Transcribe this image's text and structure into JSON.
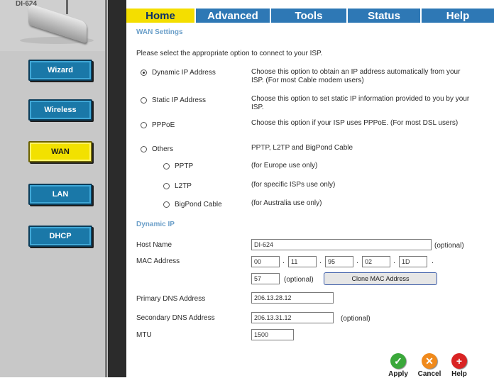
{
  "device": {
    "model": "DI-624"
  },
  "nav": {
    "items": [
      {
        "label": "Wizard"
      },
      {
        "label": "Wireless"
      },
      {
        "label": "WAN"
      },
      {
        "label": "LAN"
      },
      {
        "label": "DHCP"
      }
    ],
    "active": "WAN"
  },
  "tabs": [
    {
      "label": "Home",
      "active": true
    },
    {
      "label": "Advanced"
    },
    {
      "label": "Tools"
    },
    {
      "label": "Status"
    },
    {
      "label": "Help"
    }
  ],
  "wan": {
    "title": "WAN Settings",
    "intro": "Please select the appropriate option to connect to your ISP.",
    "options": [
      {
        "label": "Dynamic IP Address",
        "desc": "Choose this option to obtain an IP address automatically from your ISP. (For most Cable modem users)",
        "checked": true
      },
      {
        "label": "Static IP Address",
        "desc": "Choose this option to set static IP information provided to you by your ISP.",
        "checked": false
      },
      {
        "label": "PPPoE",
        "desc": "Choose this option if your ISP uses PPPoE. (For most DSL users)",
        "checked": false
      },
      {
        "label": "Others",
        "desc": "PPTP, L2TP and BigPond Cable",
        "checked": false
      }
    ],
    "sub_options": [
      {
        "label": "PPTP",
        "desc": "(for Europe use only)"
      },
      {
        "label": "L2TP",
        "desc": "(for specific ISPs use only)"
      },
      {
        "label": "BigPond Cable",
        "desc": "(for Australia use only)"
      }
    ]
  },
  "dynamic": {
    "title": "Dynamic IP",
    "host_name_label": "Host Name",
    "host_name_value": "DI-624",
    "optional": "(optional)",
    "mac_label": "MAC Address",
    "mac": [
      "00",
      "11",
      "95",
      "02",
      "1D",
      "57"
    ],
    "clone_label": "Clone MAC Address",
    "primary_dns_label": "Primary DNS Address",
    "primary_dns_value": "206.13.28.12",
    "secondary_dns_label": "Secondary DNS Address",
    "secondary_dns_value": "206.13.31.12",
    "mtu_label": "MTU",
    "mtu_value": "1500"
  },
  "actions": {
    "apply": "Apply",
    "cancel": "Cancel",
    "help": "Help"
  },
  "colors": {
    "tab_bar": "#2e78b5",
    "tab_active": "#f4de00",
    "nav_button": "#1a78a8",
    "nav_active": "#f2e100",
    "apply": "#3aa83a",
    "cancel": "#f08a1c",
    "help": "#d92323"
  }
}
